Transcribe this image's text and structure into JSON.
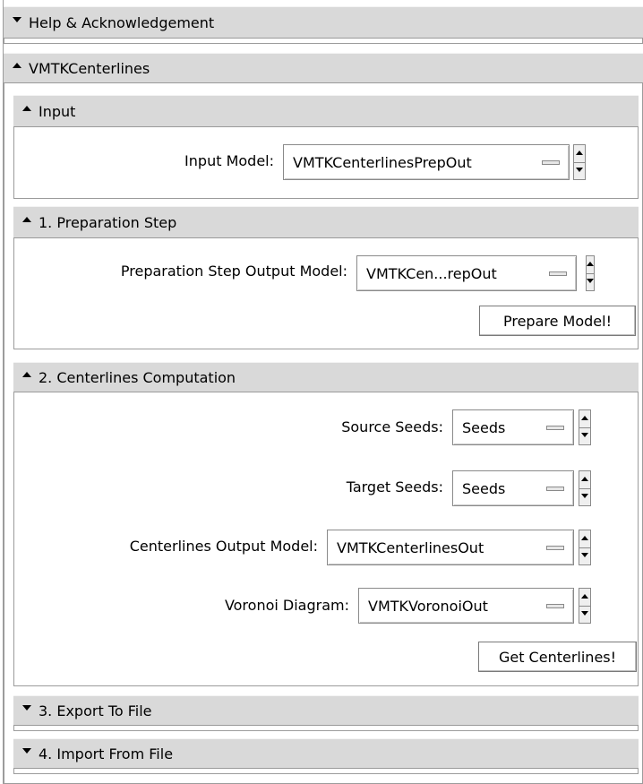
{
  "sections": {
    "help": {
      "label": "Help & Acknowledgement",
      "state": "collapsed"
    },
    "module": {
      "label": "VMTKCenterlines",
      "state": "expanded"
    },
    "input": {
      "label": "Input",
      "state": "expanded"
    },
    "prep": {
      "label": "1. Preparation Step",
      "state": "expanded"
    },
    "centerlines": {
      "label": "2. Centerlines Computation",
      "state": "expanded"
    },
    "export": {
      "label": "3. Export To File",
      "state": "collapsed"
    },
    "import": {
      "label": "4. Import From File",
      "state": "collapsed"
    }
  },
  "input": {
    "model_label": "Input Model:",
    "model_value": "VMTKCenterlinesPrepOut"
  },
  "prep": {
    "output_label": "Preparation Step Output Model:",
    "output_value": "VMTKCen...repOut",
    "button": "Prepare Model!"
  },
  "centerlines": {
    "source_label": "Source Seeds:",
    "source_value": "Seeds",
    "target_label": "Target Seeds:",
    "target_value": "Seeds",
    "output_label": "Centerlines Output Model:",
    "output_value": "VMTKCenterlinesOut",
    "voronoi_label": "Voronoi Diagram:",
    "voronoi_value": "VMTKVoronoiOut",
    "button": "Get Centerlines!"
  }
}
